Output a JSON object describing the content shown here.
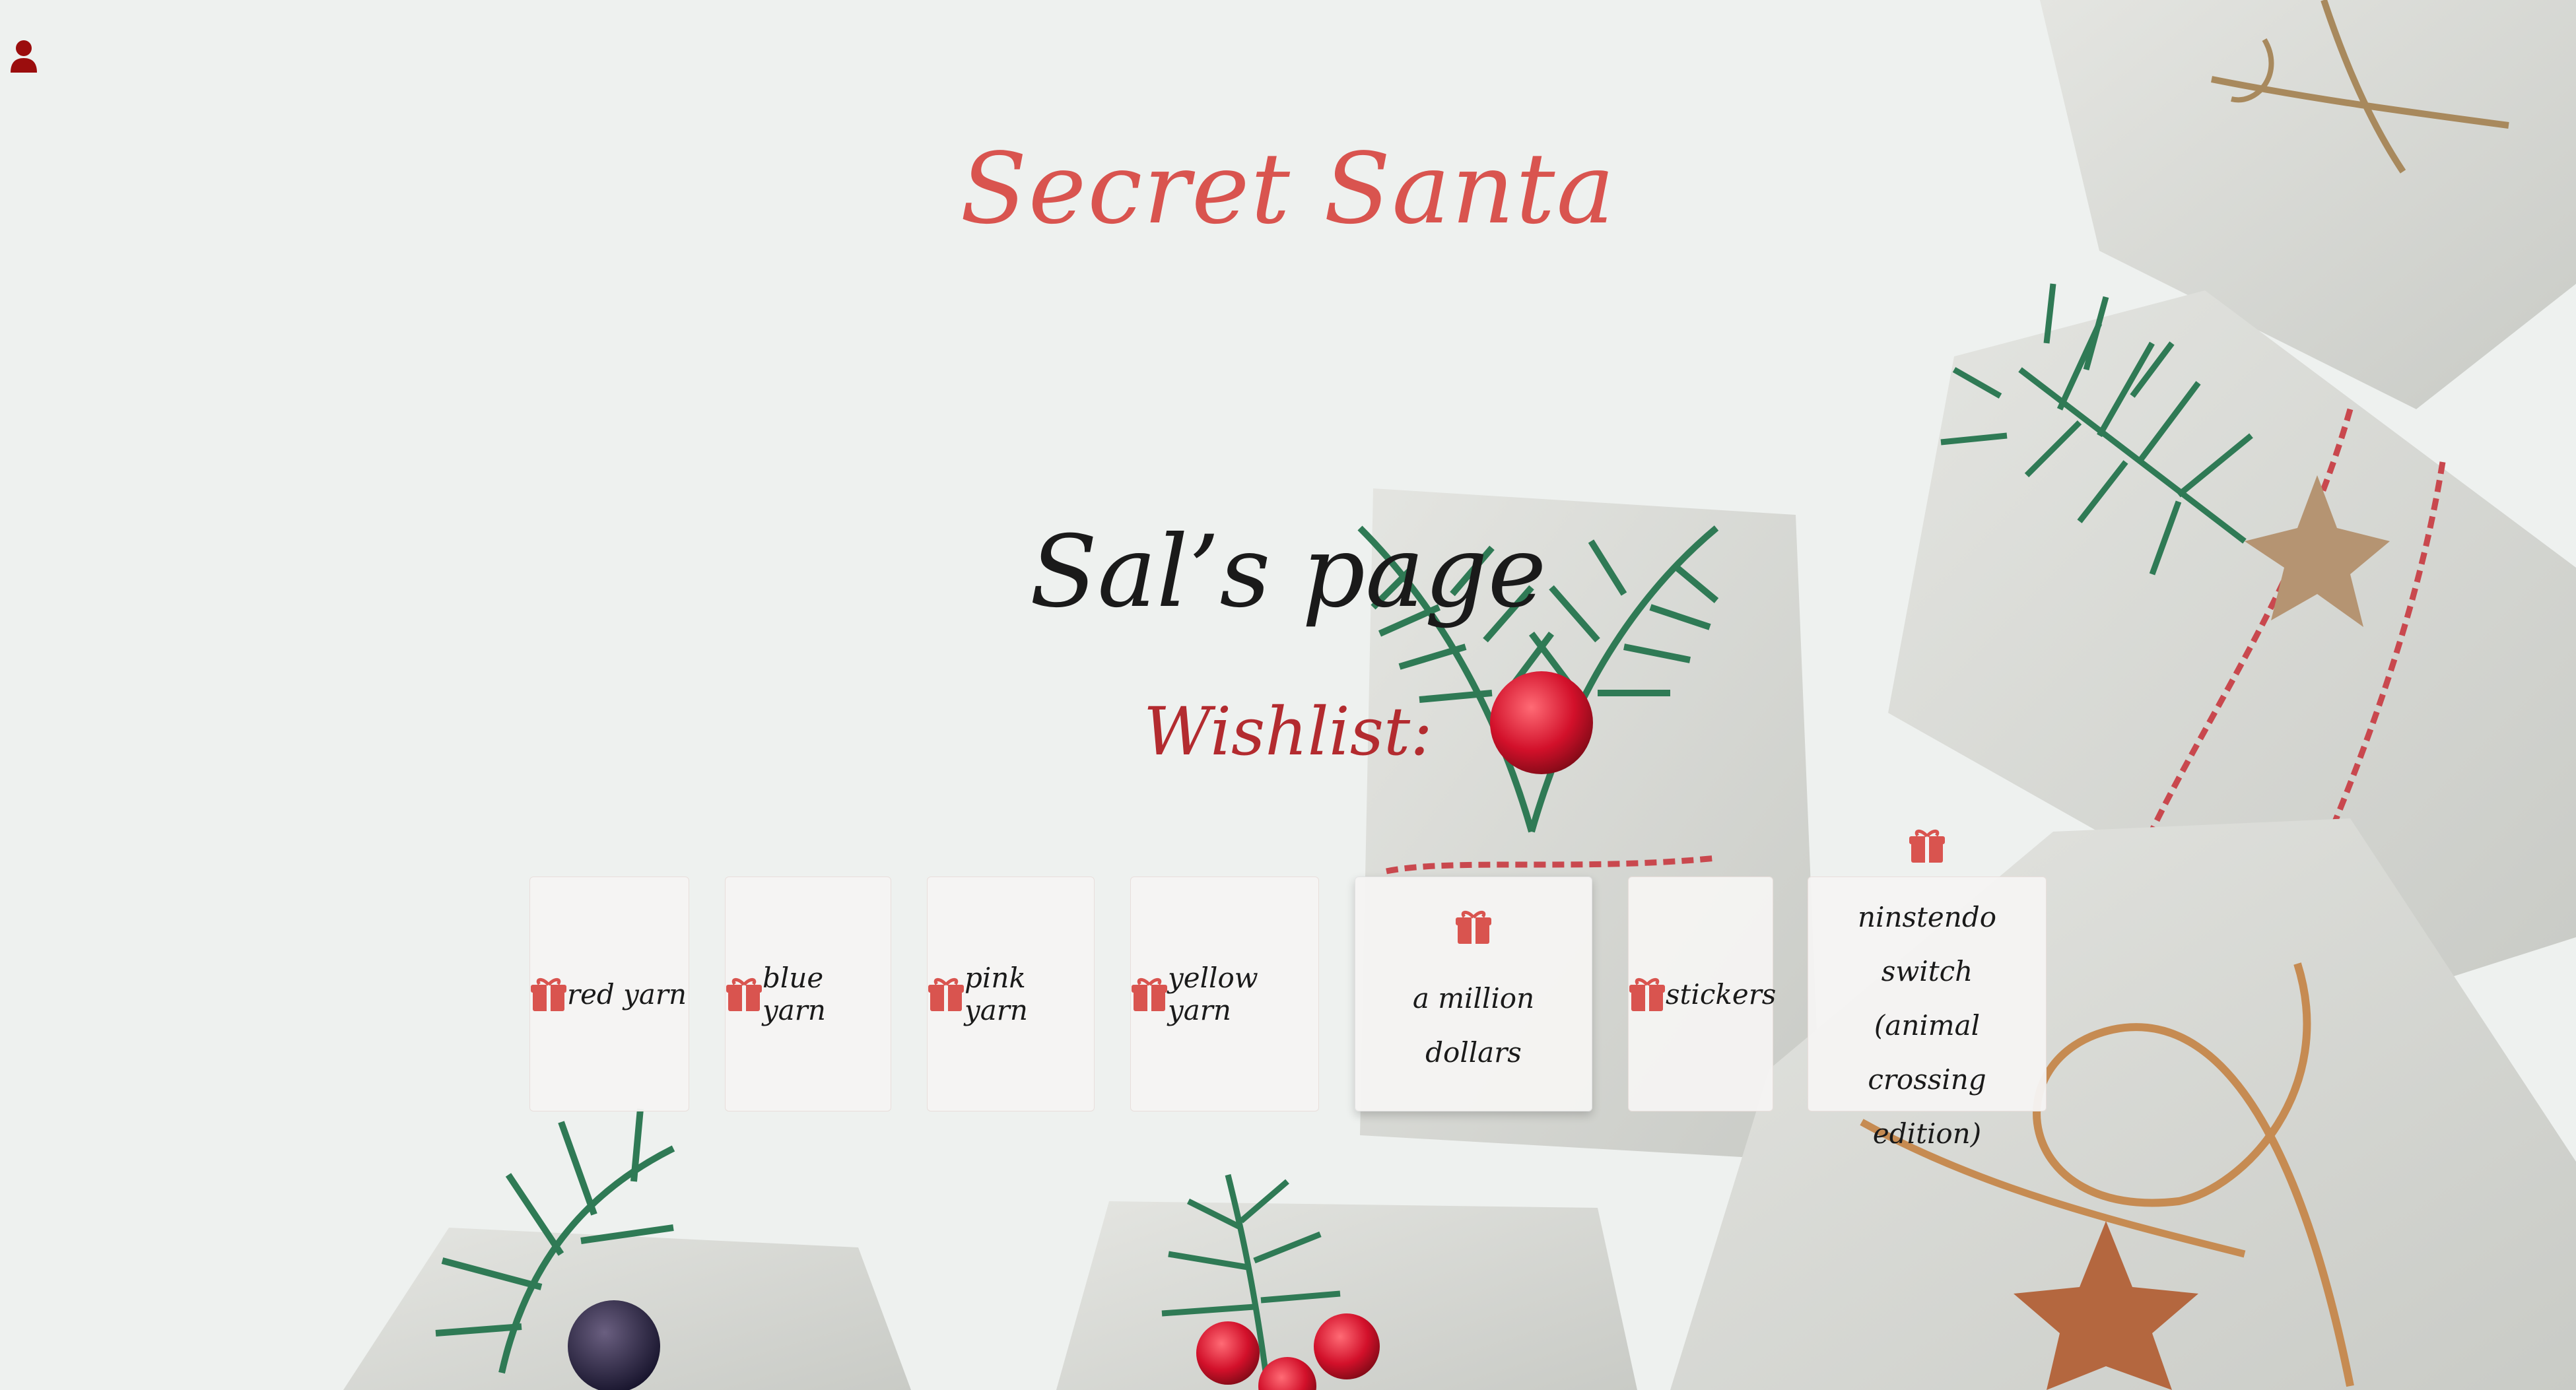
{
  "header": {
    "title": "Secret Santa"
  },
  "main": {
    "page_title": "Sal’s page",
    "wishlist_heading": "Wishlist:",
    "items": [
      {
        "label": "red yarn"
      },
      {
        "label": "blue yarn"
      },
      {
        "label": "pink yarn"
      },
      {
        "label": "yellow yarn"
      },
      {
        "label": "a million dollars"
      },
      {
        "label": "stickers"
      },
      {
        "label": "ninstendo switch (animal crossing edition)"
      }
    ]
  },
  "icons": {
    "profile": "user-icon",
    "item": "gift-icon"
  },
  "colors": {
    "accent": "#d9544f",
    "accent_dark": "#b32b2f",
    "profile": "#9b0d0d",
    "text": "#1a1a1a"
  }
}
